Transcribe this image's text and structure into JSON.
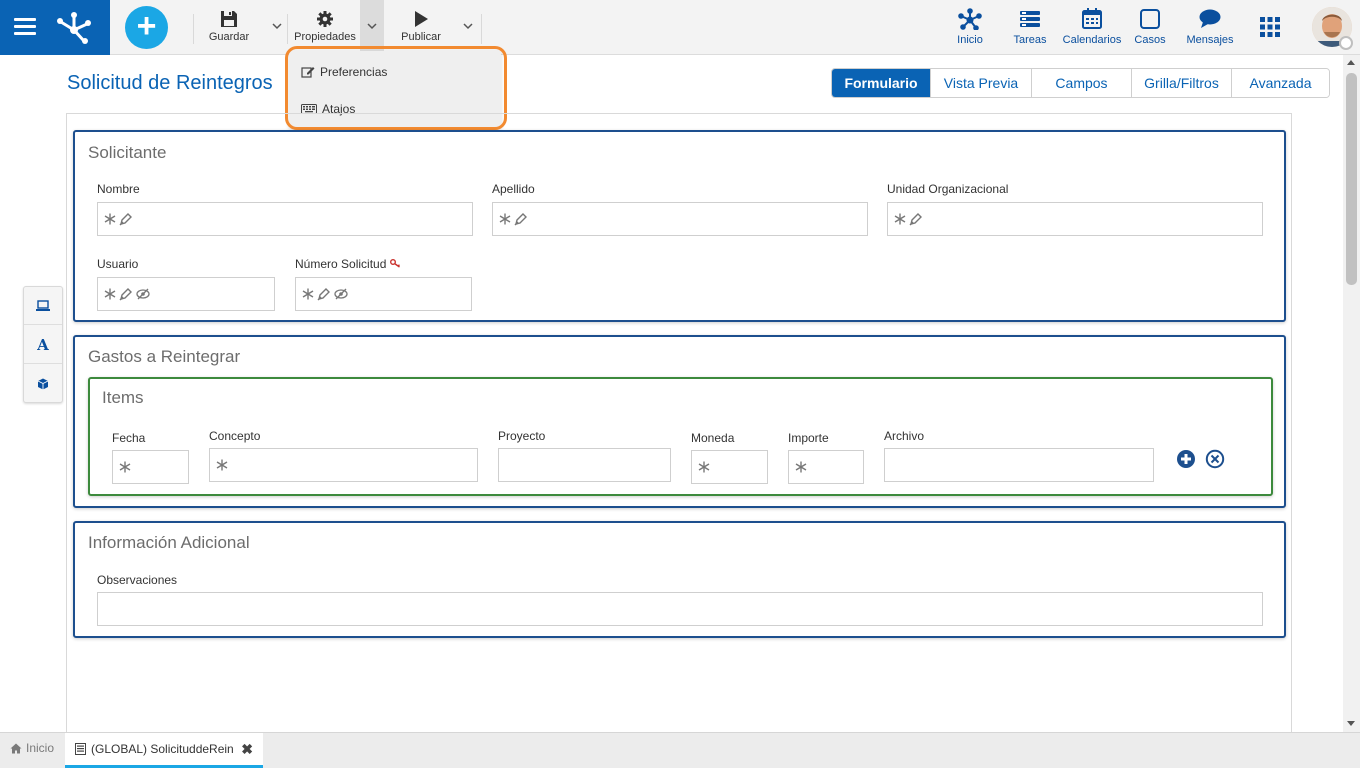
{
  "toolbar": {
    "save_label": "Guardar",
    "properties_label": "Propiedades",
    "publish_label": "Publicar"
  },
  "properties_menu": {
    "items": [
      {
        "label": "Preferencias",
        "icon": "edit-icon"
      },
      {
        "label": "Atajos",
        "icon": "keyboard-icon"
      }
    ]
  },
  "nav": {
    "items": [
      {
        "label": "Inicio",
        "icon": "network-icon"
      },
      {
        "label": "Tareas",
        "icon": "tasks-icon"
      },
      {
        "label": "Calendarios",
        "icon": "calendar-icon"
      },
      {
        "label": "Casos",
        "icon": "cases-icon"
      },
      {
        "label": "Mensajes",
        "icon": "chat-icon"
      }
    ]
  },
  "page": {
    "title": "Solicitud de Reintegros"
  },
  "tabs": [
    {
      "label": "Formulario",
      "active": true
    },
    {
      "label": "Vista Previa",
      "active": false
    },
    {
      "label": "Campos",
      "active": false
    },
    {
      "label": "Grilla/Filtros",
      "active": false
    },
    {
      "label": "Avanzada",
      "active": false
    }
  ],
  "form": {
    "solicitante": {
      "title": "Solicitante",
      "fields": {
        "nombre": "Nombre",
        "apellido": "Apellido",
        "unidad": "Unidad Organizacional",
        "usuario": "Usuario",
        "numero": "Número Solicitud"
      }
    },
    "gastos": {
      "title": "Gastos a Reintegrar",
      "grid_title": "Items",
      "columns": {
        "fecha": "Fecha",
        "concepto": "Concepto",
        "proyecto": "Proyecto",
        "moneda": "Moneda",
        "importe": "Importe",
        "archivo": "Archivo"
      }
    },
    "adicional": {
      "title": "Información Adicional",
      "fields": {
        "observaciones": "Observaciones"
      }
    }
  },
  "bottom_tabs": {
    "home_label": "Inicio",
    "doc_label": "(GLOBAL) SolicituddeRein"
  },
  "colors": {
    "brand": "#0a63b4",
    "accent": "#1ba7e5",
    "highlight": "#f28a30",
    "panel_border": "#1d4f8e",
    "grid_border": "#3d8a3d"
  }
}
